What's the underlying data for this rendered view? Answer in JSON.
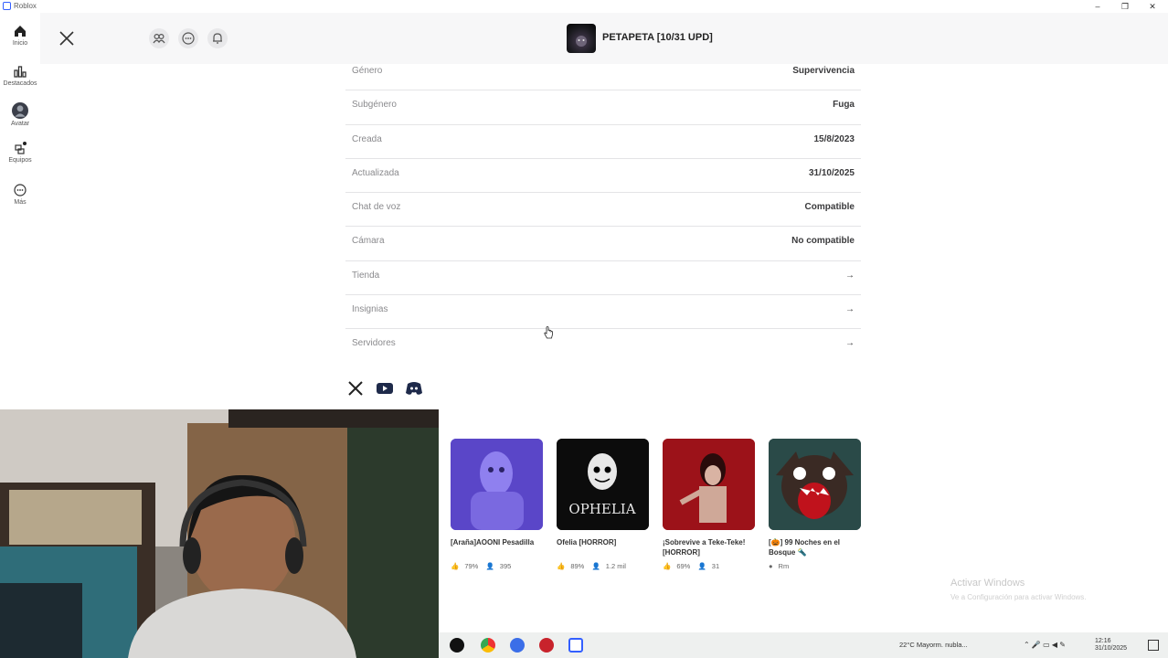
{
  "window": {
    "title": "Roblox"
  },
  "nav": {
    "items": [
      {
        "label": "Inicio",
        "icon": "home-icon"
      },
      {
        "label": "Destacados",
        "icon": "chart-icon"
      },
      {
        "label": "Avatar",
        "icon": "avatar-icon"
      },
      {
        "label": "Equipos",
        "icon": "team-icon"
      },
      {
        "label": "Más",
        "icon": "more-icon"
      }
    ]
  },
  "header": {
    "game_title": "PETAPETA [10/31 UPD]",
    "icons": [
      "close-icon",
      "friends-icon",
      "chat-icon",
      "bell-icon"
    ]
  },
  "details": [
    {
      "key": "Género",
      "value": "Supervivencia"
    },
    {
      "key": "Subgénero",
      "value": "Fuga"
    },
    {
      "key": "Creada",
      "value": "15/8/2023"
    },
    {
      "key": "Actualizada",
      "value": "31/10/2025"
    },
    {
      "key": "Chat de voz",
      "value": "Compatible"
    },
    {
      "key": "Cámara",
      "value": "No compatible"
    },
    {
      "key": "Tienda",
      "value": "→"
    },
    {
      "key": "Insignias",
      "value": "→"
    },
    {
      "key": "Servidores",
      "value": "→"
    }
  ],
  "recommendations": [
    {
      "name": "[Araña]AOONI Pesadilla",
      "rating": "79%",
      "players": "395",
      "thumb_color": "#6b57d6"
    },
    {
      "name": "Ofelia [HORROR]",
      "rating": "89%",
      "players": "1.2 mil",
      "thumb_color": "#111111",
      "thumb_text": "OPHELIA"
    },
    {
      "name": "¡Sobrevive a Teke-Teke! [HORROR]",
      "rating": "69%",
      "players": "31",
      "thumb_color": "#a0141a"
    },
    {
      "name": "[🎃] 99 Noches en el Bosque 🔦",
      "rating": "",
      "players": "Rm",
      "thumb_color": "#1f3a3a"
    }
  ],
  "watermark": {
    "line1": "Activar Windows",
    "line2": "Ve a Configuración para activar Windows."
  },
  "taskbar": {
    "weather": "22°C  Mayorm. nubla...",
    "time": "12:16",
    "date": "31/10/2025"
  }
}
